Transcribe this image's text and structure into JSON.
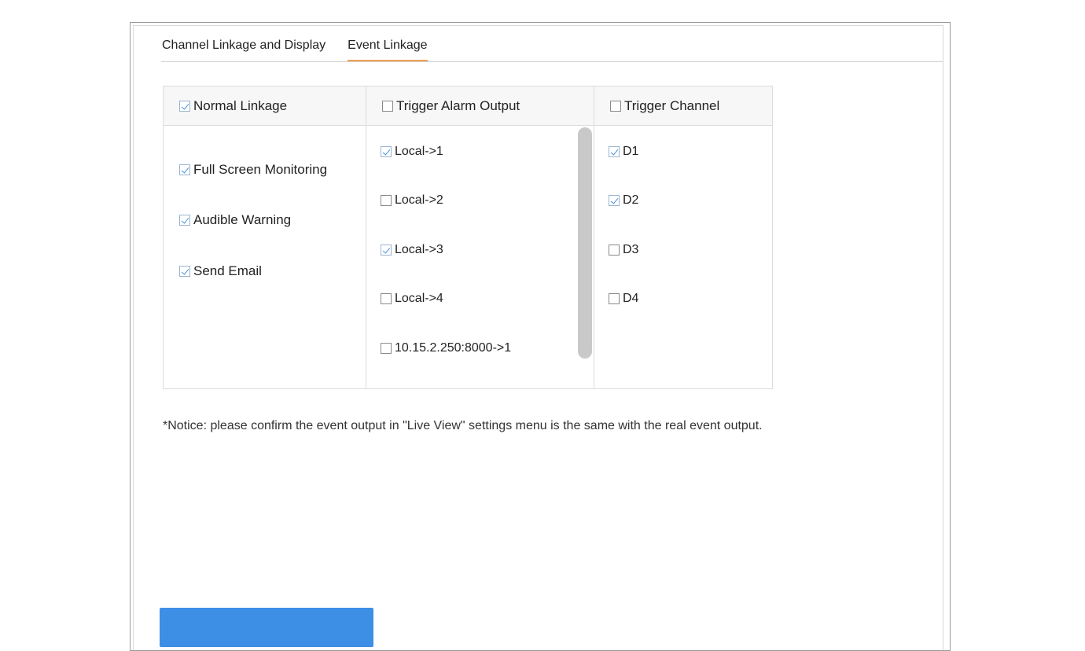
{
  "tabs": [
    {
      "label": "Channel Linkage and Display",
      "active": false
    },
    {
      "label": "Event Linkage",
      "active": true
    }
  ],
  "normal_linkage": {
    "header": "Normal Linkage",
    "header_checked": true,
    "items": [
      {
        "label": "Full Screen Monitoring",
        "checked": true
      },
      {
        "label": "Audible Warning",
        "checked": true
      },
      {
        "label": "Send Email",
        "checked": true
      }
    ]
  },
  "trigger_alarm_output": {
    "header": "Trigger Alarm Output",
    "header_checked": false,
    "items": [
      {
        "label": "Local->1",
        "checked": true
      },
      {
        "label": "Local->2",
        "checked": false
      },
      {
        "label": "Local->3",
        "checked": true
      },
      {
        "label": "Local->4",
        "checked": false
      },
      {
        "label": "10.15.2.250:8000->1",
        "checked": false
      }
    ]
  },
  "trigger_channel": {
    "header": "Trigger Channel",
    "header_checked": false,
    "items": [
      {
        "label": "D1",
        "checked": true
      },
      {
        "label": "D2",
        "checked": true
      },
      {
        "label": "D3",
        "checked": false
      },
      {
        "label": "D4",
        "checked": false
      }
    ]
  },
  "notice": "*Notice: please confirm the event output in \"Live View\" settings menu is the same with the real event output.",
  "colors": {
    "accent_tab": "#f0a050",
    "check": "#4a90d9",
    "primary_button": "#3d8fe6"
  }
}
